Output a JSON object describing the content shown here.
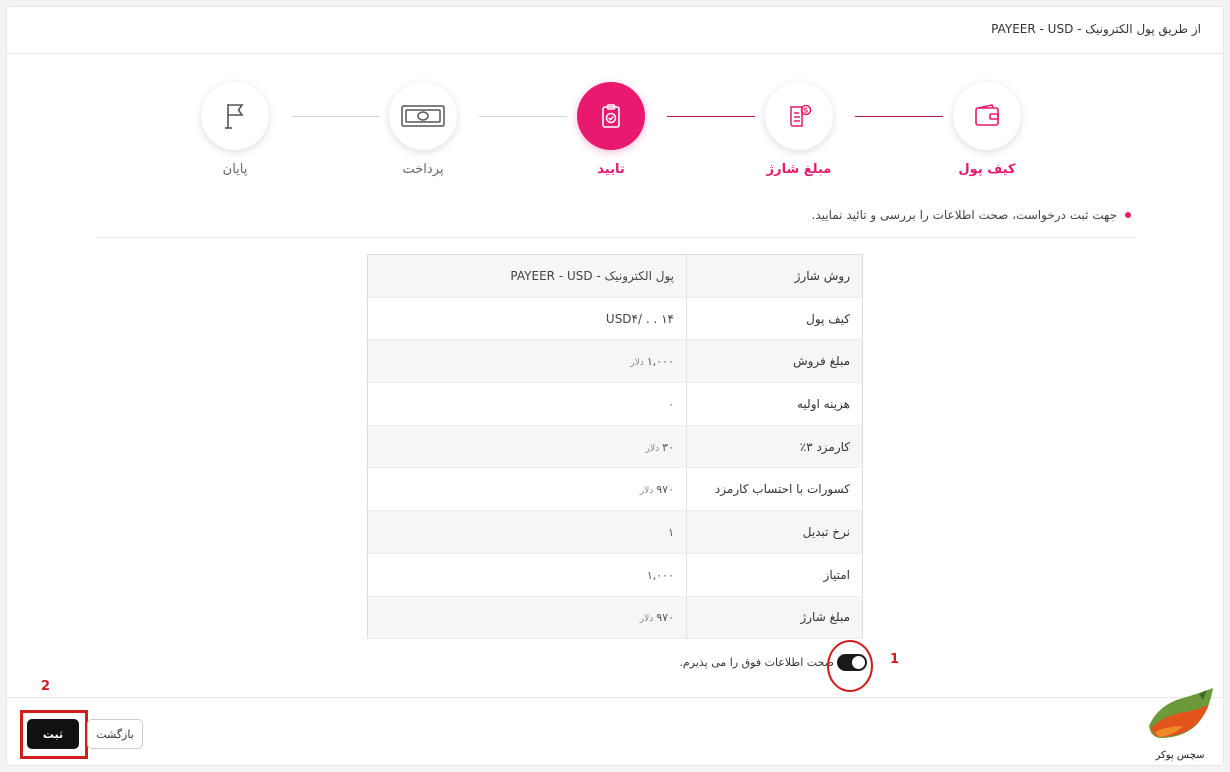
{
  "header": {
    "title": "از طریق پول الکترونیک - PAYEER - USD"
  },
  "colors": {
    "accent": "#e8196e",
    "connector_done": "#b3164f",
    "annotation": "#d21d1d",
    "submit_bg": "#111111"
  },
  "steps": [
    {
      "label": "کیف پول",
      "icon": "wallet-icon",
      "state": "done"
    },
    {
      "label": "مبلغ شارژ",
      "icon": "invoice-dollar-icon",
      "state": "done"
    },
    {
      "label": "تایید",
      "icon": "clipboard-check-icon",
      "state": "active"
    },
    {
      "label": "پرداخت",
      "icon": "banknote-icon",
      "state": "pending"
    },
    {
      "label": "پایان",
      "icon": "flag-icon",
      "state": "pending"
    }
  ],
  "note": "جهت ثبت درخواست، صحت اطلاعات را بررسی و تائید نمایید.",
  "table": {
    "rows": [
      {
        "label": "روش شارژ",
        "value": "پول الکترونیک - PAYEER - USD"
      },
      {
        "label": "کیف پول",
        "value": "USD۴/ . . ۱۴"
      },
      {
        "label": "مبلغ فروش",
        "value": "۱,۰۰۰",
        "unit": "دلار"
      },
      {
        "label": "هزینه اولیه",
        "value": "۰"
      },
      {
        "label": "کارمزد ۳٪",
        "value": "۳۰",
        "unit": "دلار"
      },
      {
        "label": "کسورات با احتساب کارمزد",
        "value": "۹۷۰",
        "unit": "دلار"
      },
      {
        "label": "نرخ تبدیل",
        "value": "۱"
      },
      {
        "label": "امتیاز",
        "value": "۱,۰۰۰"
      },
      {
        "label": "مبلغ شارژ",
        "value": "۹۷۰",
        "unit": "دلار"
      }
    ]
  },
  "accept": {
    "label": "صحت اطلاعات فوق را می پذیرم.",
    "checked": true
  },
  "annotations": {
    "mark1": "1",
    "mark2": "2"
  },
  "buttons": {
    "submit": "ثبت",
    "back": "بازگشت"
  },
  "watermark": {
    "text": "سچس پوکر"
  }
}
